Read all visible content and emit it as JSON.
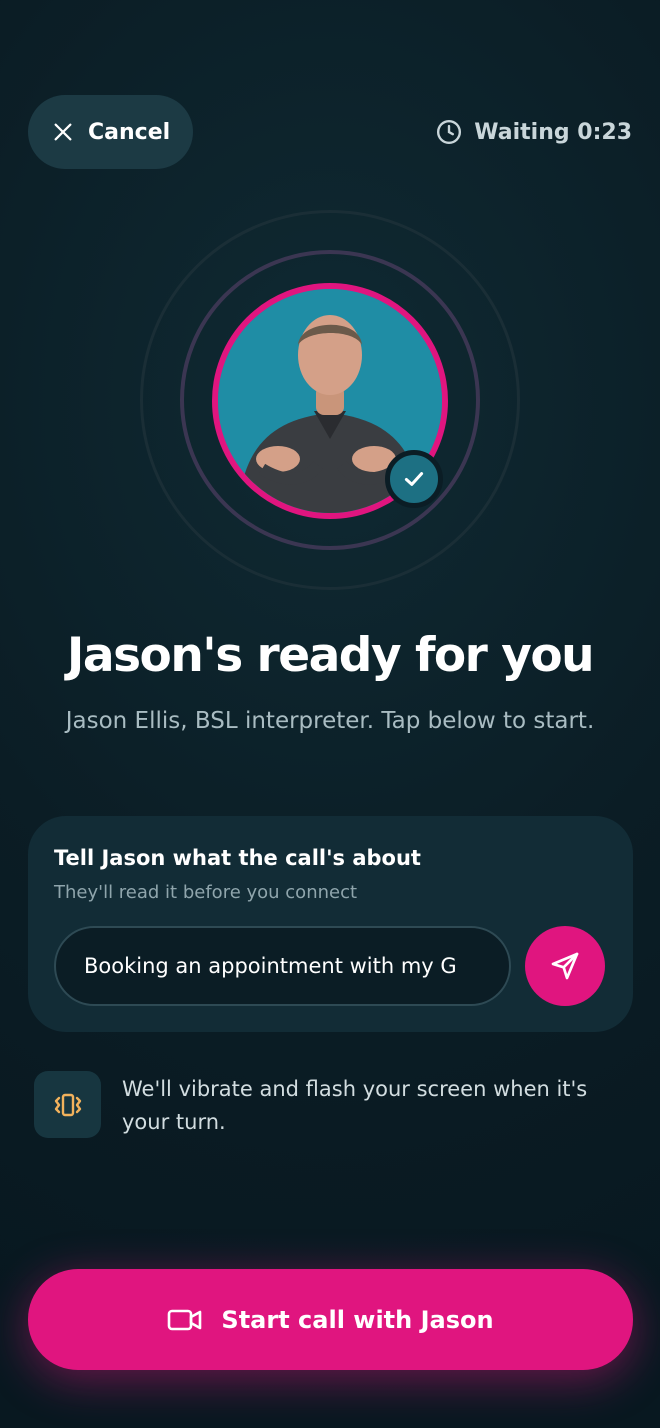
{
  "header": {
    "cancel_label": "Cancel",
    "waiting_label": "Waiting 0:23"
  },
  "interpreter": {
    "headline": "Jason's ready for you",
    "subline": "Jason Ellis, BSL interpreter. Tap below to start."
  },
  "note": {
    "title": "Tell Jason what the call's about",
    "hint": "They'll read it before you connect",
    "input_value": "Booking an appointment with my G"
  },
  "notice": {
    "text": "We'll vibrate and flash your screen when it's your turn."
  },
  "cta": {
    "label": "Start call with Jason"
  },
  "icons": {
    "cancel": "close-icon",
    "waiting": "clock-icon",
    "status": "check-icon",
    "send": "send-icon",
    "notice": "vibrate-icon",
    "cta": "video-camera-icon"
  },
  "colors": {
    "accent": "#e0157f",
    "badge": "#1d7083",
    "background": "#0b1d25"
  }
}
